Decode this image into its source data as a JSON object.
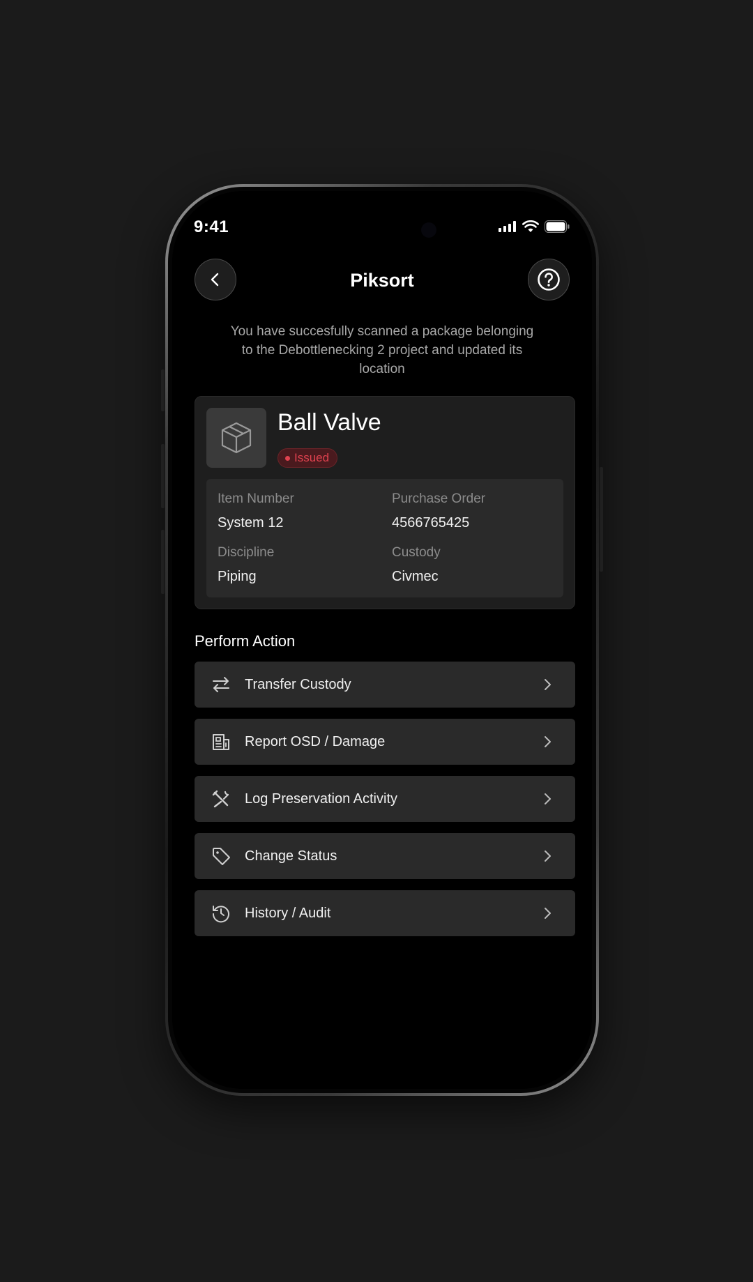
{
  "status_bar": {
    "time": "9:41"
  },
  "header": {
    "title": "Piksort"
  },
  "message": "You have succesfully scanned a package belonging to the Debottlenecking 2 project and updated its location",
  "item": {
    "name": "Ball Valve",
    "status": "Issued",
    "fields": [
      {
        "label": "Item Number",
        "value": "System 12"
      },
      {
        "label": "Purchase Order",
        "value": "4566765425"
      },
      {
        "label": "Discipline",
        "value": "Piping"
      },
      {
        "label": "Custody",
        "value": "Civmec"
      }
    ]
  },
  "actions_section": {
    "title": "Perform Action",
    "items": [
      {
        "label": "Transfer Custody",
        "icon": "transfer-arrows-icon"
      },
      {
        "label": "Report OSD / Damage",
        "icon": "report-document-icon"
      },
      {
        "label": "Log Preservation Activity",
        "icon": "tools-icon"
      },
      {
        "label": "Change Status",
        "icon": "tag-icon"
      },
      {
        "label": "History / Audit",
        "icon": "history-icon"
      }
    ]
  },
  "colors": {
    "background": "#1b1b1b",
    "screen": "#000000",
    "card": "#1e1e1e",
    "row": "#2a2a2a",
    "status_issued": "#e0424f"
  }
}
